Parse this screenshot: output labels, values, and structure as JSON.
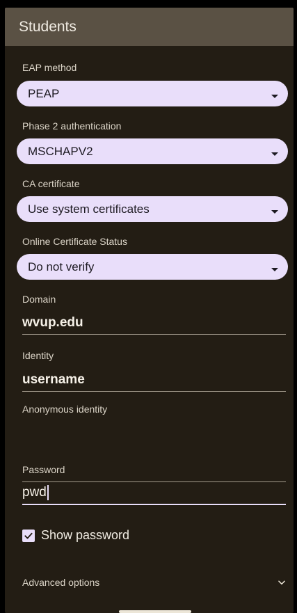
{
  "dialog": {
    "title": "Students"
  },
  "fields": {
    "eap_method": {
      "label": "EAP method",
      "value": "PEAP"
    },
    "phase2": {
      "label": "Phase 2 authentication",
      "value": "MSCHAPV2"
    },
    "ca_cert": {
      "label": "CA certificate",
      "value": "Use system certificates"
    },
    "ocsp": {
      "label": "Online Certificate Status",
      "value": "Do not verify"
    },
    "domain": {
      "label": "Domain",
      "value": "wvup.edu"
    },
    "identity": {
      "label": "Identity",
      "value": "username"
    },
    "anon_identity": {
      "label": "Anonymous identity",
      "value": ""
    },
    "password": {
      "label": "Password",
      "value": "pwd"
    }
  },
  "show_password": {
    "label": "Show password",
    "checked": true
  },
  "advanced": {
    "label": "Advanced options"
  },
  "icons": {
    "dropdown": "dropdown-arrow-icon",
    "checkbox": "check-icon",
    "advanced": "chevron-down-icon"
  },
  "colors": {
    "background": "#231d14",
    "title_bar": "#5a5144",
    "accent": "#e9defa"
  }
}
